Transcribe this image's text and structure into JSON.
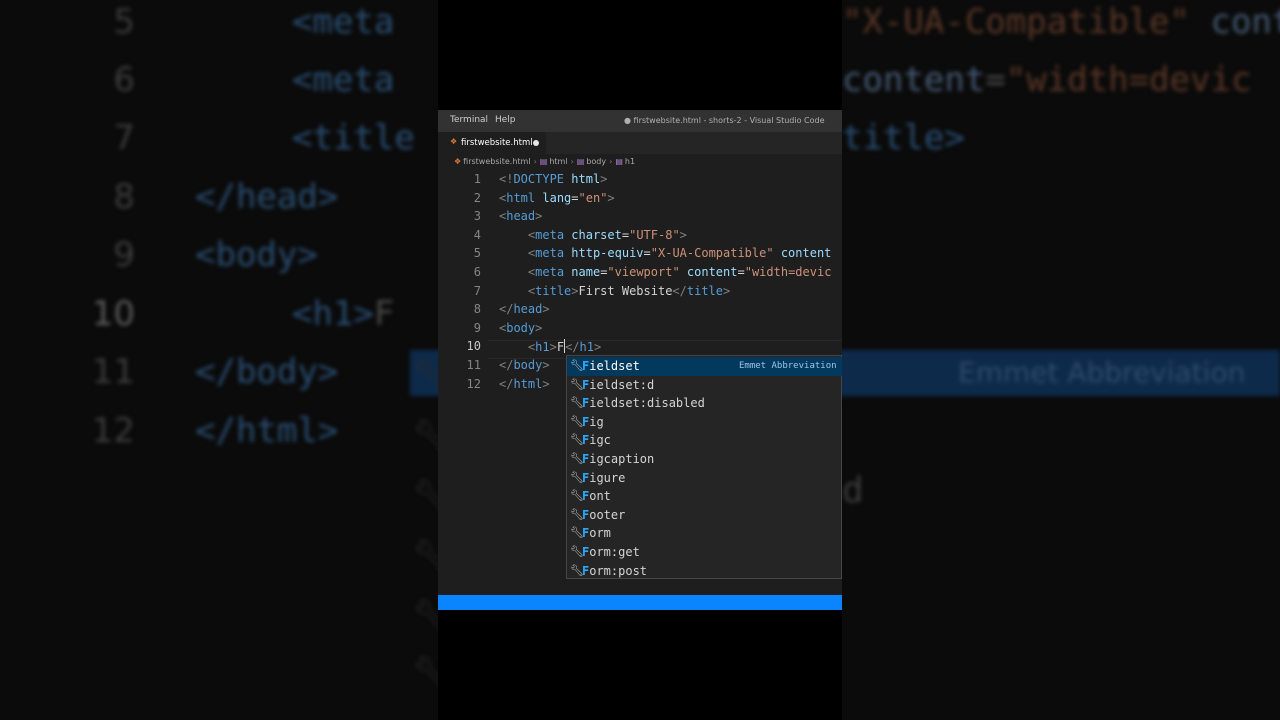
{
  "menu": {
    "terminal": "Terminal",
    "help": "Help"
  },
  "window_title": "● firstwebsite.html - shorts-2 - Visual Studio Code",
  "tab": {
    "label": "firstwebsite.html",
    "modified": true,
    "icon": "html-file-icon"
  },
  "breadcrumb": [
    "firstwebsite.html",
    "html",
    "body",
    "h1"
  ],
  "editor": {
    "current_line": 10,
    "lines": [
      {
        "n": "1",
        "tokens": [
          [
            "p",
            "<!"
          ],
          [
            "t",
            "DOCTYPE"
          ],
          [
            "x",
            " "
          ],
          [
            "a",
            "html"
          ],
          [
            "p",
            ">"
          ]
        ]
      },
      {
        "n": "2",
        "tokens": [
          [
            "p",
            "<"
          ],
          [
            "t",
            "html"
          ],
          [
            "x",
            " "
          ],
          [
            "a",
            "lang"
          ],
          [
            "x",
            "="
          ],
          [
            "s",
            "\"en\""
          ],
          [
            "p",
            ">"
          ]
        ]
      },
      {
        "n": "3",
        "tokens": [
          [
            "p",
            "<"
          ],
          [
            "t",
            "head"
          ],
          [
            "p",
            ">"
          ]
        ]
      },
      {
        "n": "4",
        "tokens": [
          [
            "x",
            "    "
          ],
          [
            "p",
            "<"
          ],
          [
            "t",
            "meta"
          ],
          [
            "x",
            " "
          ],
          [
            "a",
            "charset"
          ],
          [
            "x",
            "="
          ],
          [
            "s",
            "\"UTF-8\""
          ],
          [
            "p",
            ">"
          ]
        ]
      },
      {
        "n": "5",
        "tokens": [
          [
            "x",
            "    "
          ],
          [
            "p",
            "<"
          ],
          [
            "t",
            "meta"
          ],
          [
            "x",
            " "
          ],
          [
            "a",
            "http-equiv"
          ],
          [
            "x",
            "="
          ],
          [
            "s",
            "\"X-UA-Compatible\""
          ],
          [
            "x",
            " "
          ],
          [
            "a",
            "content"
          ]
        ]
      },
      {
        "n": "6",
        "tokens": [
          [
            "x",
            "    "
          ],
          [
            "p",
            "<"
          ],
          [
            "t",
            "meta"
          ],
          [
            "x",
            " "
          ],
          [
            "a",
            "name"
          ],
          [
            "x",
            "="
          ],
          [
            "s",
            "\"viewport\""
          ],
          [
            "x",
            " "
          ],
          [
            "a",
            "content"
          ],
          [
            "x",
            "="
          ],
          [
            "s",
            "\"width=devic"
          ]
        ]
      },
      {
        "n": "7",
        "tokens": [
          [
            "x",
            "    "
          ],
          [
            "p",
            "<"
          ],
          [
            "t",
            "title"
          ],
          [
            "p",
            ">"
          ],
          [
            "x",
            "First Website"
          ],
          [
            "p",
            "</"
          ],
          [
            "t",
            "title"
          ],
          [
            "p",
            ">"
          ]
        ]
      },
      {
        "n": "8",
        "tokens": [
          [
            "p",
            "</"
          ],
          [
            "t",
            "head"
          ],
          [
            "p",
            ">"
          ]
        ]
      },
      {
        "n": "9",
        "tokens": [
          [
            "p",
            "<"
          ],
          [
            "t",
            "body"
          ],
          [
            "p",
            ">"
          ]
        ]
      },
      {
        "n": "10",
        "tokens": [
          [
            "x",
            "    "
          ],
          [
            "p",
            "<"
          ],
          [
            "t",
            "h1"
          ],
          [
            "p",
            ">"
          ],
          [
            "x",
            "F"
          ]
        ],
        "after_caret": [
          [
            "p",
            "</"
          ],
          [
            "t",
            "h1"
          ],
          [
            "p",
            ">"
          ]
        ]
      },
      {
        "n": "11",
        "tokens": [
          [
            "p",
            "</"
          ],
          [
            "t",
            "body"
          ],
          [
            "p",
            ">"
          ]
        ]
      },
      {
        "n": "12",
        "tokens": [
          [
            "p",
            "</"
          ],
          [
            "t",
            "html"
          ],
          [
            "p",
            ">"
          ]
        ]
      }
    ]
  },
  "suggestions": {
    "match": "F",
    "detail": "Emmet Abbreviation",
    "selected_index": 0,
    "icon": "wrench-icon",
    "items": [
      "Fieldset",
      "Fieldset:d",
      "Fieldset:disabled",
      "Fig",
      "Figc",
      "Figcaption",
      "Figure",
      "Font",
      "Footer",
      "Form",
      "Form:get",
      "Form:post"
    ]
  },
  "colors": {
    "statusbar": "#0a84ff",
    "selected": "#04395e",
    "editor_bg": "#1e1e1e"
  }
}
